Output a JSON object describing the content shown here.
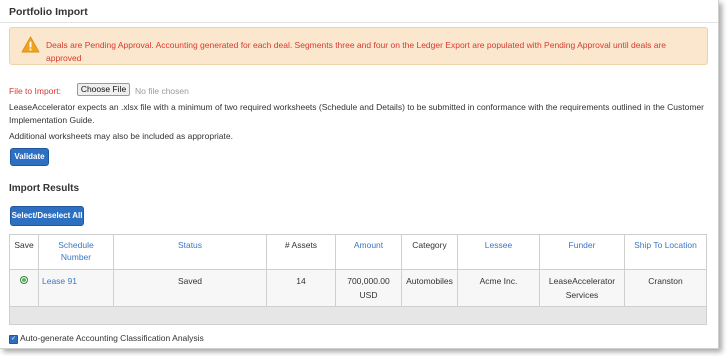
{
  "page": {
    "title": "Portfolio Import"
  },
  "alert": {
    "icon": "warning-triangle-icon",
    "color": "#d83a2f",
    "background": "#fbe7cd",
    "message": "Deals are Pending Approval. Accounting generated for each deal. Segments three and four on the Ledger Export are populated with Pending Approval until deals are approved"
  },
  "file_import": {
    "label": "File to Import:",
    "button_label": "Choose File",
    "status": "No file chosen"
  },
  "description": "LeaseAccelerator expects an .xlsx file with a minimum of two required worksheets (Schedule and Details) to be submitted in conformance with the requirements outlined in the Customer Implementation Guide.",
  "note": "Additional worksheets may also be included as appropriate.",
  "validate_button": "Validate",
  "import_results": {
    "title": "Import Results",
    "select_button": "Select/Deselect All",
    "columns": [
      "Save",
      "Schedule Number",
      "Status",
      "# Assets",
      "Amount",
      "Category",
      "Lessee",
      "Funder",
      "Ship To Location"
    ],
    "rows": [
      {
        "selected": true,
        "schedule_number": "Lease 91",
        "status": "Saved",
        "assets": "14",
        "amount": "700,000.00 USD",
        "category": "Automobiles",
        "lessee": "Acme Inc.",
        "funder": "LeaseAccelerator Services",
        "ship_to_location": "Cranston"
      }
    ]
  },
  "auto_generate": {
    "checked": true,
    "label": "Auto-generate Accounting Classification Analysis"
  },
  "colors": {
    "accent": "#2d6fc0",
    "link": "#3a78c4",
    "error_text": "#d83a2f"
  }
}
